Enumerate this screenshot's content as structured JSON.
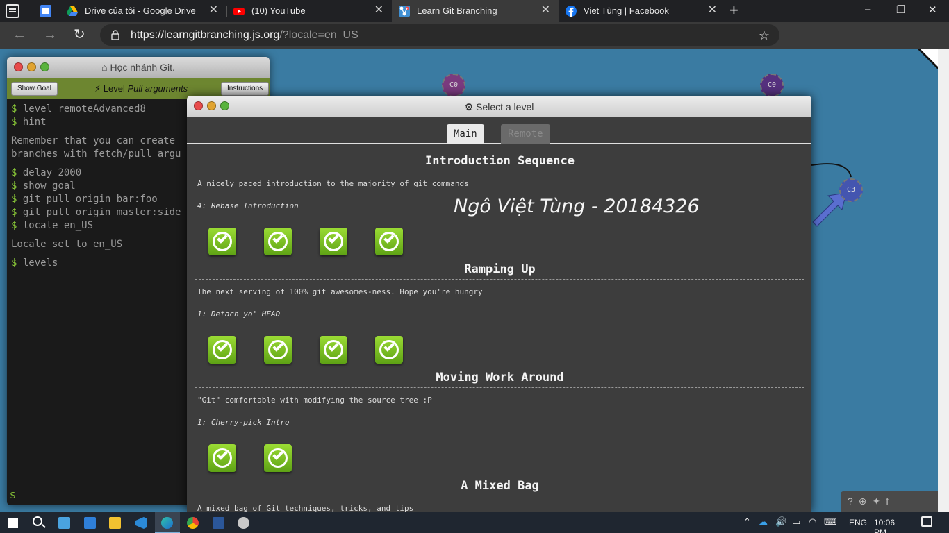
{
  "browser": {
    "tabs": [
      {
        "label": "Drive của tôi - Google Drive",
        "icon": "google-drive-icon",
        "active": false
      },
      {
        "label": "(10) YouTube",
        "icon": "youtube-icon",
        "active": false
      },
      {
        "label": "Learn Git Branching",
        "icon": "git-branching-icon",
        "active": true
      },
      {
        "label": "Viet Tùng | Facebook",
        "icon": "facebook-icon",
        "active": false
      }
    ],
    "tab_close_glyph": "✕",
    "new_tab_glyph": "+",
    "window_controls": [
      "–",
      "❐",
      "✕"
    ],
    "nav": {
      "back": "←",
      "forward": "→",
      "refresh": "↻"
    },
    "url_host": "https://learngitbranching.js.org",
    "url_path": "/?locale=en_US",
    "menu_glyph": "···"
  },
  "graph": {
    "nodes": [
      "C0",
      "C0",
      "C3"
    ]
  },
  "terminal": {
    "title": "Học nhánh Git.",
    "show_goal": "Show Goal",
    "level_prefix": "Level",
    "level_name": "Pull arguments",
    "instructions": "Instructions",
    "prompt": "$",
    "lines": [
      {
        "type": "cmd",
        "text": "level remoteAdvanced8"
      },
      {
        "type": "cmd",
        "text": "hint"
      },
      {
        "type": "gap"
      },
      {
        "type": "out",
        "text": "Remember that you can create"
      },
      {
        "type": "out",
        "text": "branches with fetch/pull argu"
      },
      {
        "type": "gap"
      },
      {
        "type": "cmd",
        "text": "delay 2000"
      },
      {
        "type": "cmd",
        "text": "show goal"
      },
      {
        "type": "cmd",
        "text": "git pull origin bar:foo"
      },
      {
        "type": "cmd",
        "text": "git pull origin master:side"
      },
      {
        "type": "cmd",
        "text": "locale en_US"
      },
      {
        "type": "gap"
      },
      {
        "type": "out",
        "text": "Locale set to en_US"
      },
      {
        "type": "gap"
      },
      {
        "type": "cmd",
        "text": "levels"
      }
    ]
  },
  "modal": {
    "title": "Select a level",
    "tabs": {
      "main": "Main",
      "remote": "Remote"
    },
    "author_note": "Ngô Việt Tùng - 20184326",
    "sections": [
      {
        "title": "Introduction Sequence",
        "description": "A nicely paced introduction to the majority of git commands",
        "current_level": "4: Rebase Introduction",
        "levels_completed": 4
      },
      {
        "title": "Ramping Up",
        "description": "The next serving of 100% git awesomes-ness. Hope you're hungry",
        "current_level": "1: Detach yo' HEAD",
        "levels_completed": 4
      },
      {
        "title": "Moving Work Around",
        "description": "\"Git\" comfortable with modifying the source tree :P",
        "current_level": "1: Cherry-pick Intro",
        "levels_completed": 2
      },
      {
        "title": "A Mixed Bag",
        "description": "A mixed bag of Git techniques, tricks, and tips",
        "current_level": "",
        "levels_completed": 0
      }
    ]
  },
  "social_icons": [
    "?",
    "⊕",
    "bird",
    "f"
  ],
  "taskbar": {
    "lang": "ENG",
    "time": "10:06 PM"
  }
}
